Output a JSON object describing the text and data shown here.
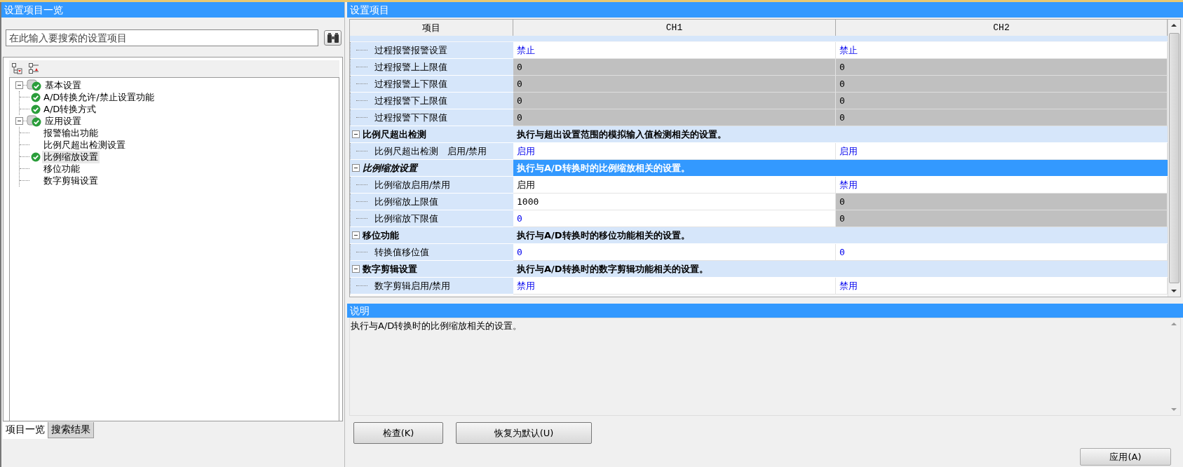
{
  "left_panel": {
    "title": "设置项目一览",
    "search": {
      "placeholder": "在此输入要搜索的设置项目"
    },
    "tree": [
      {
        "label": "基本设置",
        "checked": true,
        "expanded": true,
        "selected": false,
        "children": [
          {
            "label": "A/D转换允许/禁止设置功能",
            "checked": true,
            "selected": false
          },
          {
            "label": "A/D转换方式",
            "checked": true,
            "selected": false
          }
        ]
      },
      {
        "label": "应用设置",
        "checked": true,
        "expanded": true,
        "selected": false,
        "children": [
          {
            "label": "报警输出功能",
            "checked": false,
            "selected": false
          },
          {
            "label": "比例尺超出检测设置",
            "checked": false,
            "selected": false
          },
          {
            "label": "比例缩放设置",
            "checked": true,
            "selected": true
          },
          {
            "label": "移位功能",
            "checked": false,
            "selected": false
          },
          {
            "label": "数字剪辑设置",
            "checked": false,
            "selected": false
          }
        ]
      }
    ],
    "tabs": [
      {
        "label": "项目一览",
        "selected": true
      },
      {
        "label": "搜索结果",
        "selected": false
      }
    ]
  },
  "right_panel": {
    "title": "设置项目",
    "table": {
      "columns": [
        "项目",
        "CH1",
        "CH2"
      ],
      "rows": [
        {
          "kind": "item",
          "name": "过程报警报警设置",
          "values": [
            {
              "text": "禁止",
              "changed": false,
              "disabled": false
            },
            {
              "text": "禁止",
              "changed": false,
              "disabled": false
            }
          ]
        },
        {
          "kind": "item",
          "name": "过程报警上上限值",
          "values": [
            {
              "text": "0",
              "disabled": true
            },
            {
              "text": "0",
              "disabled": true
            }
          ]
        },
        {
          "kind": "item",
          "name": "过程报警上下限值",
          "values": [
            {
              "text": "0",
              "disabled": true
            },
            {
              "text": "0",
              "disabled": true
            }
          ]
        },
        {
          "kind": "item",
          "name": "过程报警下上限值",
          "values": [
            {
              "text": "0",
              "disabled": true
            },
            {
              "text": "0",
              "disabled": true
            }
          ]
        },
        {
          "kind": "item",
          "name": "过程报警下下限值",
          "values": [
            {
              "text": "0",
              "disabled": true
            },
            {
              "text": "0",
              "disabled": true
            }
          ]
        },
        {
          "kind": "group",
          "name": "比例尺超出检测",
          "description": "执行与超出设置范围的模拟输入值检测相关的设置。",
          "expanded": true,
          "selected": false
        },
        {
          "kind": "item",
          "name": "比例尺超出检测　启用/禁用",
          "values": [
            {
              "text": "启用",
              "changed": false,
              "disabled": false
            },
            {
              "text": "启用",
              "changed": false,
              "disabled": false
            }
          ]
        },
        {
          "kind": "group",
          "name": "比例缩放设置",
          "description": "执行与A/D转换时的比例缩放相关的设置。",
          "expanded": true,
          "selected": true
        },
        {
          "kind": "item",
          "name": "比例缩放启用/禁用",
          "values": [
            {
              "text": "启用",
              "changed": true,
              "disabled": false
            },
            {
              "text": "禁用",
              "changed": false,
              "disabled": false
            }
          ]
        },
        {
          "kind": "item",
          "name": "比例缩放上限值",
          "values": [
            {
              "text": "1000",
              "changed": true,
              "disabled": false
            },
            {
              "text": "0",
              "disabled": true
            }
          ]
        },
        {
          "kind": "item",
          "name": "比例缩放下限值",
          "values": [
            {
              "text": "0",
              "changed": false,
              "disabled": false
            },
            {
              "text": "0",
              "disabled": true
            }
          ]
        },
        {
          "kind": "group",
          "name": "移位功能",
          "description": "执行与A/D转换时的移位功能相关的设置。",
          "expanded": true,
          "selected": false
        },
        {
          "kind": "item",
          "name": "转换值移位值",
          "values": [
            {
              "text": "0",
              "changed": false,
              "disabled": false
            },
            {
              "text": "0",
              "changed": false,
              "disabled": false
            }
          ]
        },
        {
          "kind": "group",
          "name": "数字剪辑设置",
          "description": "执行与A/D转换时的数字剪辑功能相关的设置。",
          "expanded": true,
          "selected": false
        },
        {
          "kind": "item",
          "name": "数字剪辑启用/禁用",
          "values": [
            {
              "text": "禁用",
              "changed": false,
              "disabled": false
            },
            {
              "text": "禁用",
              "changed": false,
              "disabled": false
            }
          ]
        }
      ]
    },
    "description": {
      "title": "说明",
      "text": "执行与A/D转换时的比例缩放相关的设置。"
    },
    "buttons": [
      {
        "label": "检查(K)"
      },
      {
        "label": "恢复为默认(U)"
      }
    ],
    "apply_button": {
      "label": "应用(A)"
    }
  }
}
